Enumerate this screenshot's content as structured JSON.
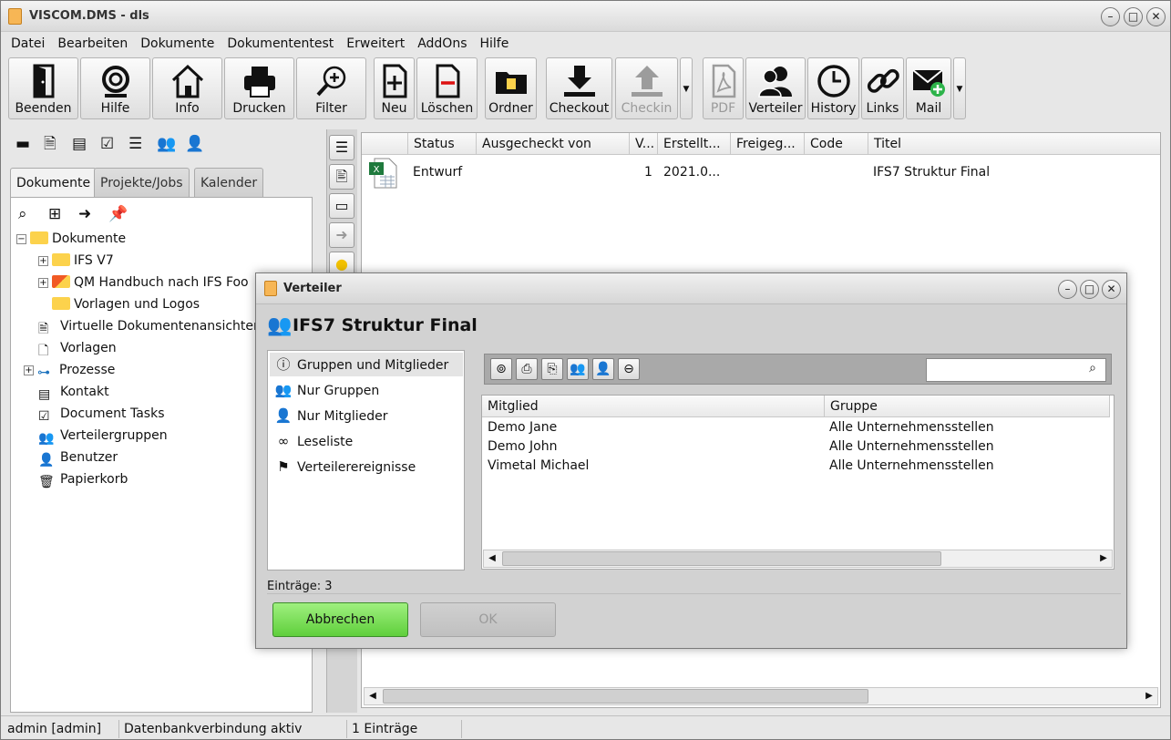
{
  "window": {
    "title": "VISCOM.DMS - dls",
    "min": "–",
    "max": "□",
    "close": "✕"
  },
  "menu": [
    "Datei",
    "Bearbeiten",
    "Dokumente",
    "Dokumententest",
    "Erweitert",
    "AddOns",
    "Hilfe"
  ],
  "toolbar": {
    "beenden": "Beenden",
    "hilfe": "Hilfe",
    "info": "Info",
    "drucken": "Drucken",
    "filter": "Filter",
    "neu": "Neu",
    "loeschen": "Löschen",
    "ordner": "Ordner",
    "checkout": "Checkout",
    "checkin": "Checkin",
    "pdf": "PDF",
    "verteiler": "Verteiler",
    "history": "History",
    "links": "Links",
    "mail": "Mail"
  },
  "left": {
    "tabs": [
      "Dokumente",
      "Projekte/Jobs",
      "Kalender"
    ],
    "tree": {
      "dokumente": "Dokumente",
      "ifs_v7": "IFS V7",
      "qm": "QM Handbuch nach IFS Foo",
      "vorlagen_logos": "Vorlagen und Logos",
      "virtuelle": "Virtuelle Dokumentenansichten",
      "vorlagen": "Vorlagen",
      "prozesse": "Prozesse",
      "kontakt": "Kontakt",
      "tasks": "Document Tasks",
      "verteilergruppen": "Verteilergruppen",
      "benutzer": "Benutzer",
      "papierkorb": "Papierkorb"
    }
  },
  "table": {
    "columns": [
      "Status",
      "Ausgecheckt von",
      "V...",
      "Erstellt...",
      "Freigeg...",
      "Code",
      "Titel"
    ],
    "rows": [
      {
        "status": "Entwurf",
        "ausgecheckt": "",
        "version": "1",
        "erstellt": "2021.0...",
        "freigegeben": "",
        "code": "",
        "titel": "IFS7 Struktur Final"
      }
    ]
  },
  "status": {
    "user": "admin [admin]",
    "db": "Datenbankverbindung aktiv",
    "count": "1 Einträge"
  },
  "dialog": {
    "title": "Verteiler",
    "heading": "IFS7 Struktur Final",
    "nav": [
      "Gruppen und Mitglieder",
      "Nur Gruppen",
      "Nur Mitglieder",
      "Leseliste",
      "Verteilerereignisse"
    ],
    "search": {
      "value": "",
      "placeholder": ""
    },
    "columns": [
      "Mitglied",
      "Gruppe"
    ],
    "rows": [
      {
        "mitglied": "Demo Jane",
        "gruppe": "Alle Unternehmensstellen"
      },
      {
        "mitglied": "Demo John",
        "gruppe": "Alle Unternehmensstellen"
      },
      {
        "mitglied": "Vimetal Michael",
        "gruppe": "Alle Unternehmensstellen"
      }
    ],
    "count": "Einträge: 3",
    "cancel": "Abbrechen",
    "ok": "OK"
  },
  "colors": {
    "cancel_button": "#6bd847",
    "folder": "#fcd24c",
    "window_bg": "#e7e7e7"
  }
}
